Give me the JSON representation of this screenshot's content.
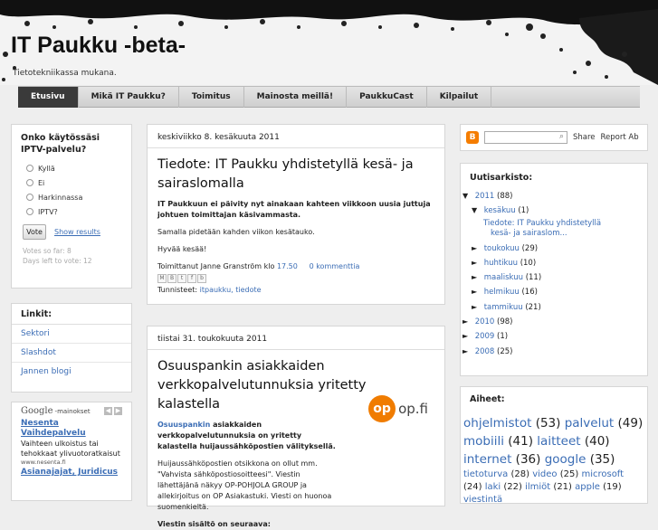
{
  "blog": {
    "title": "IT Paukku -beta-",
    "description": "Tietotekniikassa mukana."
  },
  "nav": {
    "items": [
      "Etusivu",
      "Mikä IT Paukku?",
      "Toimitus",
      "Mainosta meillä!",
      "PaukkuCast",
      "Kilpailut"
    ]
  },
  "poll": {
    "question": "Onko käytössäsi IPTV-palvelu?",
    "options": [
      "Kyllä",
      "Ei",
      "Harkinnassa",
      "IPTV?"
    ],
    "vote_label": "Vote",
    "results_label": "Show results",
    "votes": "Votes so far: 8",
    "days_left": "Days left to vote: 12"
  },
  "links": {
    "title": "Linkit:",
    "items": [
      "Sektori",
      "Slashdot",
      "Jannen blogi"
    ]
  },
  "ads": {
    "google": "Google",
    "label": "-mainokset",
    "ad1_title": "Nesenta Vaihdepalvelu",
    "ad1_text": "Vaihteen ulkoistus tai tehokkaat ylivuotoratkaisut",
    "ad1_url": "www.nesenta.fi",
    "ad2_title": "Asianajajat, Juridicus"
  },
  "post1": {
    "date": "keskiviikko 8. kesäkuuta 2011",
    "title": "Tiedote: IT Paukku yhdistetyllä kesä- ja sairaslomalla",
    "p1": "IT Paukkuun ei päivity nyt ainakaan kahteen viikkoon uusia juttuja johtuen toimittajan käsivammasta.",
    "p2": "Samalla pidetään kahden viikon kesätauko.",
    "p3": "Hyvää kesää!",
    "posted_by": "Toimittanut Janne Granström klo",
    "time": "17.50",
    "comments": "0 kommenttia",
    "tags_label": "Tunnisteet:",
    "tags": "itpaukku, tiedote"
  },
  "post2": {
    "date": "tiistai 31. toukokuuta 2011",
    "title": "Osuuspankin asiakkaiden verkkopalvelutunnuksia yritetty kalastella",
    "bank": "Osuuspankin",
    "p1": "asiakkaiden verkkopalvelutunnuksia on yritetty kalastella huijaussähköpostien välityksellä.",
    "p2": "Huijaussähköpostien otsikkona on ollut mm. \"Vahvista sähköpostiosoitteesi\". Viestin lähettäjänä näkyy OP-POHJOLA GROUP ja allekirjoitus on OP Asiakastuki. Viesti on huonoa suomenkieltä.",
    "p3": "Viestin sisältö on seuraava:",
    "logo": "op.fi"
  },
  "search": {
    "share": "Share",
    "report": "Report Ab"
  },
  "archive": {
    "title": "Uutisarkisto:",
    "rows": [
      {
        "tri": "▼",
        "label": "2011",
        "count": "(88)"
      },
      {
        "tri": "▼",
        "label": "kesäkuu",
        "count": "(1)"
      },
      {
        "tri": "",
        "label": "Tiedote: IT Paukku yhdistetyllä",
        "count": ""
      },
      {
        "tri": "",
        "label": "kesä- ja sairaslom...",
        "count": ""
      },
      {
        "tri": "►",
        "label": "toukokuu",
        "count": "(29)"
      },
      {
        "tri": "►",
        "label": "huhtikuu",
        "count": "(10)"
      },
      {
        "tri": "►",
        "label": "maaliskuu",
        "count": "(11)"
      },
      {
        "tri": "►",
        "label": "helmikuu",
        "count": "(16)"
      },
      {
        "tri": "►",
        "label": "tammikuu",
        "count": "(21)"
      },
      {
        "tri": "►",
        "label": "2010",
        "count": "(98)"
      },
      {
        "tri": "►",
        "label": "2009",
        "count": "(1)"
      },
      {
        "tri": "►",
        "label": "2008",
        "count": "(25)"
      }
    ]
  },
  "tags": {
    "title": "Aiheet:",
    "large": [
      {
        "label": "ohjelmistot",
        "count": "(53)"
      },
      {
        "label": "palvelut",
        "count": "(49)"
      },
      {
        "label": "mobiili",
        "count": "(41)"
      },
      {
        "label": "laitteet",
        "count": "(40)"
      },
      {
        "label": "internet",
        "count": "(36)"
      },
      {
        "label": "google",
        "count": "(35)"
      }
    ],
    "small": [
      {
        "label": "tietoturva",
        "count": "(28)"
      },
      {
        "label": "video",
        "count": "(25)"
      },
      {
        "label": "microsoft",
        "count": "(24)"
      },
      {
        "label": "laki",
        "count": "(22)"
      },
      {
        "label": "ilmiöt",
        "count": "(21)"
      },
      {
        "label": "apple",
        "count": "(19)"
      },
      {
        "label": "viestintä",
        "count": ""
      }
    ]
  }
}
